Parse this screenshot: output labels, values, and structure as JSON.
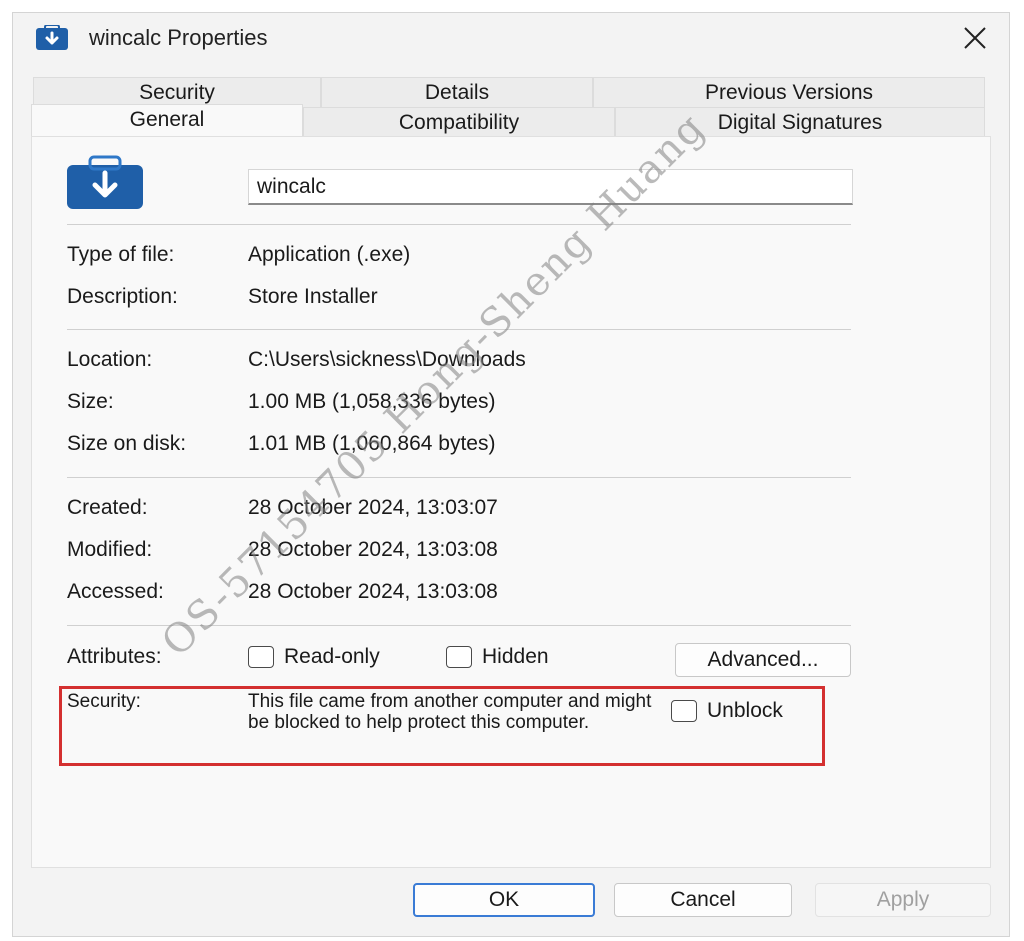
{
  "window": {
    "title": "wincalc Properties",
    "icon": "download-box-icon",
    "close_icon": "close-icon"
  },
  "tabs": {
    "row_back": [
      "Security",
      "Details",
      "Previous Versions"
    ],
    "row_front": [
      "General",
      "Compatibility",
      "Digital Signatures"
    ],
    "active": "General"
  },
  "general": {
    "file_name": "wincalc",
    "type_label": "Type of file:",
    "type_value": "Application (.exe)",
    "description_label": "Description:",
    "description_value": "Store Installer",
    "location_label": "Location:",
    "location_value": "C:\\Users\\sickness\\Downloads",
    "size_label": "Size:",
    "size_value": "1.00 MB (1,058,336 bytes)",
    "size_on_disk_label": "Size on disk:",
    "size_on_disk_value": "1.01 MB (1,060,864 bytes)",
    "created_label": "Created:",
    "created_value": "28 October 2024, 13:03:07",
    "modified_label": "Modified:",
    "modified_value": "28 October 2024, 13:03:08",
    "accessed_label": "Accessed:",
    "accessed_value": "28 October 2024, 13:03:08",
    "attributes_label": "Attributes:",
    "readonly_label": "Read-only",
    "readonly_checked": false,
    "hidden_label": "Hidden",
    "hidden_checked": false,
    "advanced_label": "Advanced...",
    "security_label": "Security:",
    "security_text": "This file came from another computer and might be blocked to help protect this computer.",
    "unblock_label": "Unblock",
    "unblock_checked": false
  },
  "buttons": {
    "ok": "OK",
    "cancel": "Cancel",
    "apply": "Apply"
  },
  "colors": {
    "highlight_box": "#d43030",
    "icon_blue": "#1f5fa8",
    "primary_button_border": "#3a7bd5"
  },
  "watermark": "OS-57154705 Hong-Sheng Huang"
}
